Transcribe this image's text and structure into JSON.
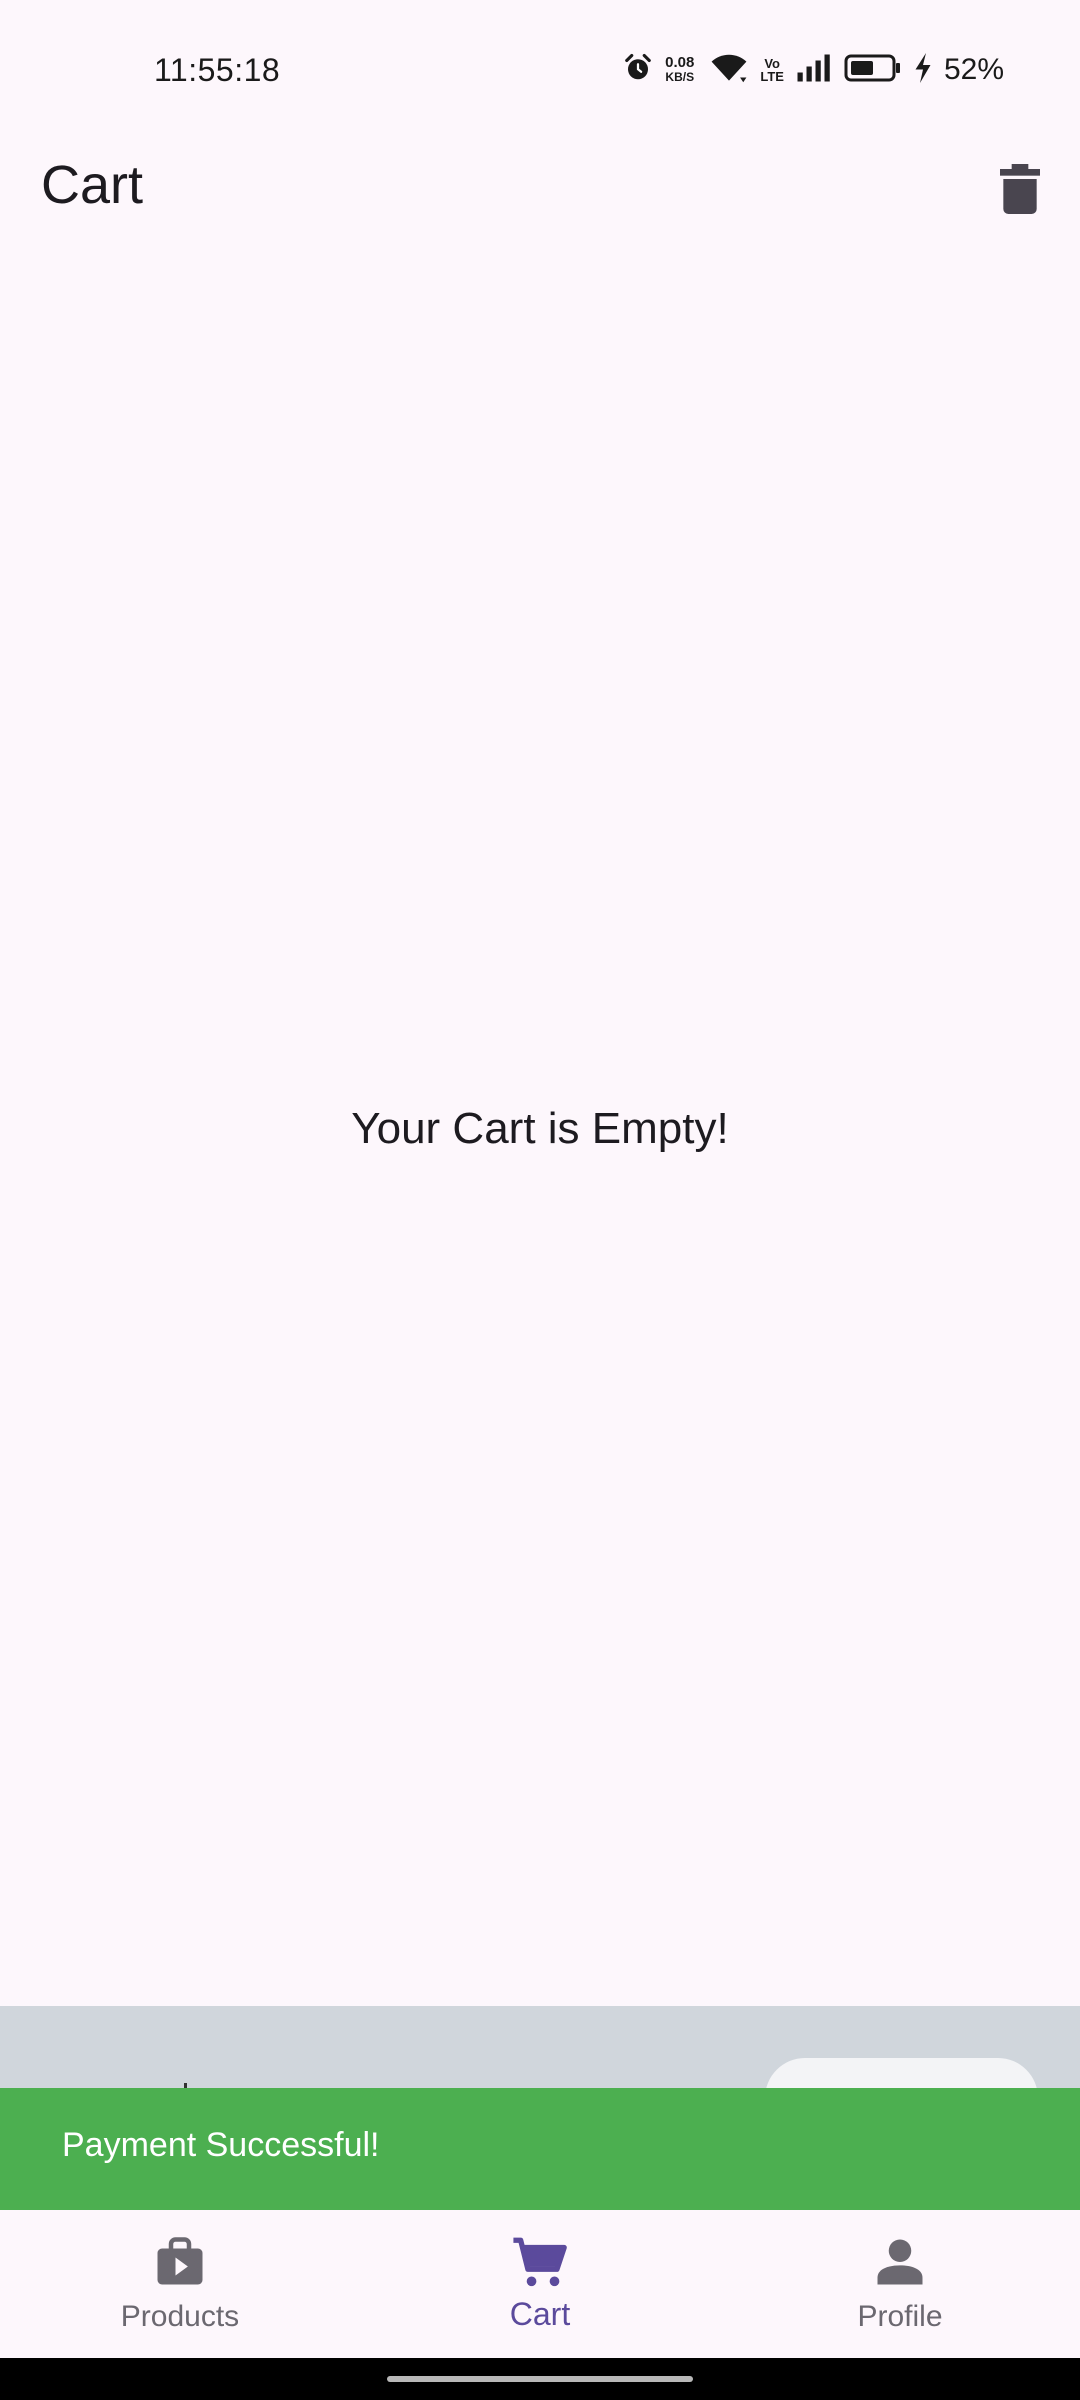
{
  "status_bar": {
    "time": "11:55:18",
    "net_speed_value": "0.08",
    "net_speed_unit": "KB/S",
    "volte_top": "Vo",
    "volte_bottom": "LTE",
    "battery_percent": "52%",
    "icons": [
      "alarm-icon",
      "wifi-icon",
      "signal-icon",
      "battery-icon",
      "charging-icon"
    ]
  },
  "app_bar": {
    "title": "Cart",
    "action_icon": "trash-icon"
  },
  "main": {
    "empty_message": "Your Cart is Empty!"
  },
  "snackbar": {
    "message": "Payment Successful!",
    "color": "#4caf50"
  },
  "bottom_nav": {
    "items": [
      {
        "label": "Products",
        "icon": "shopping-bag-icon",
        "active": false
      },
      {
        "label": "Cart",
        "icon": "cart-icon",
        "active": true
      },
      {
        "label": "Profile",
        "icon": "person-icon",
        "active": false
      }
    ],
    "active_color": "#5b4a9c",
    "inactive_color": "#6b6870"
  }
}
